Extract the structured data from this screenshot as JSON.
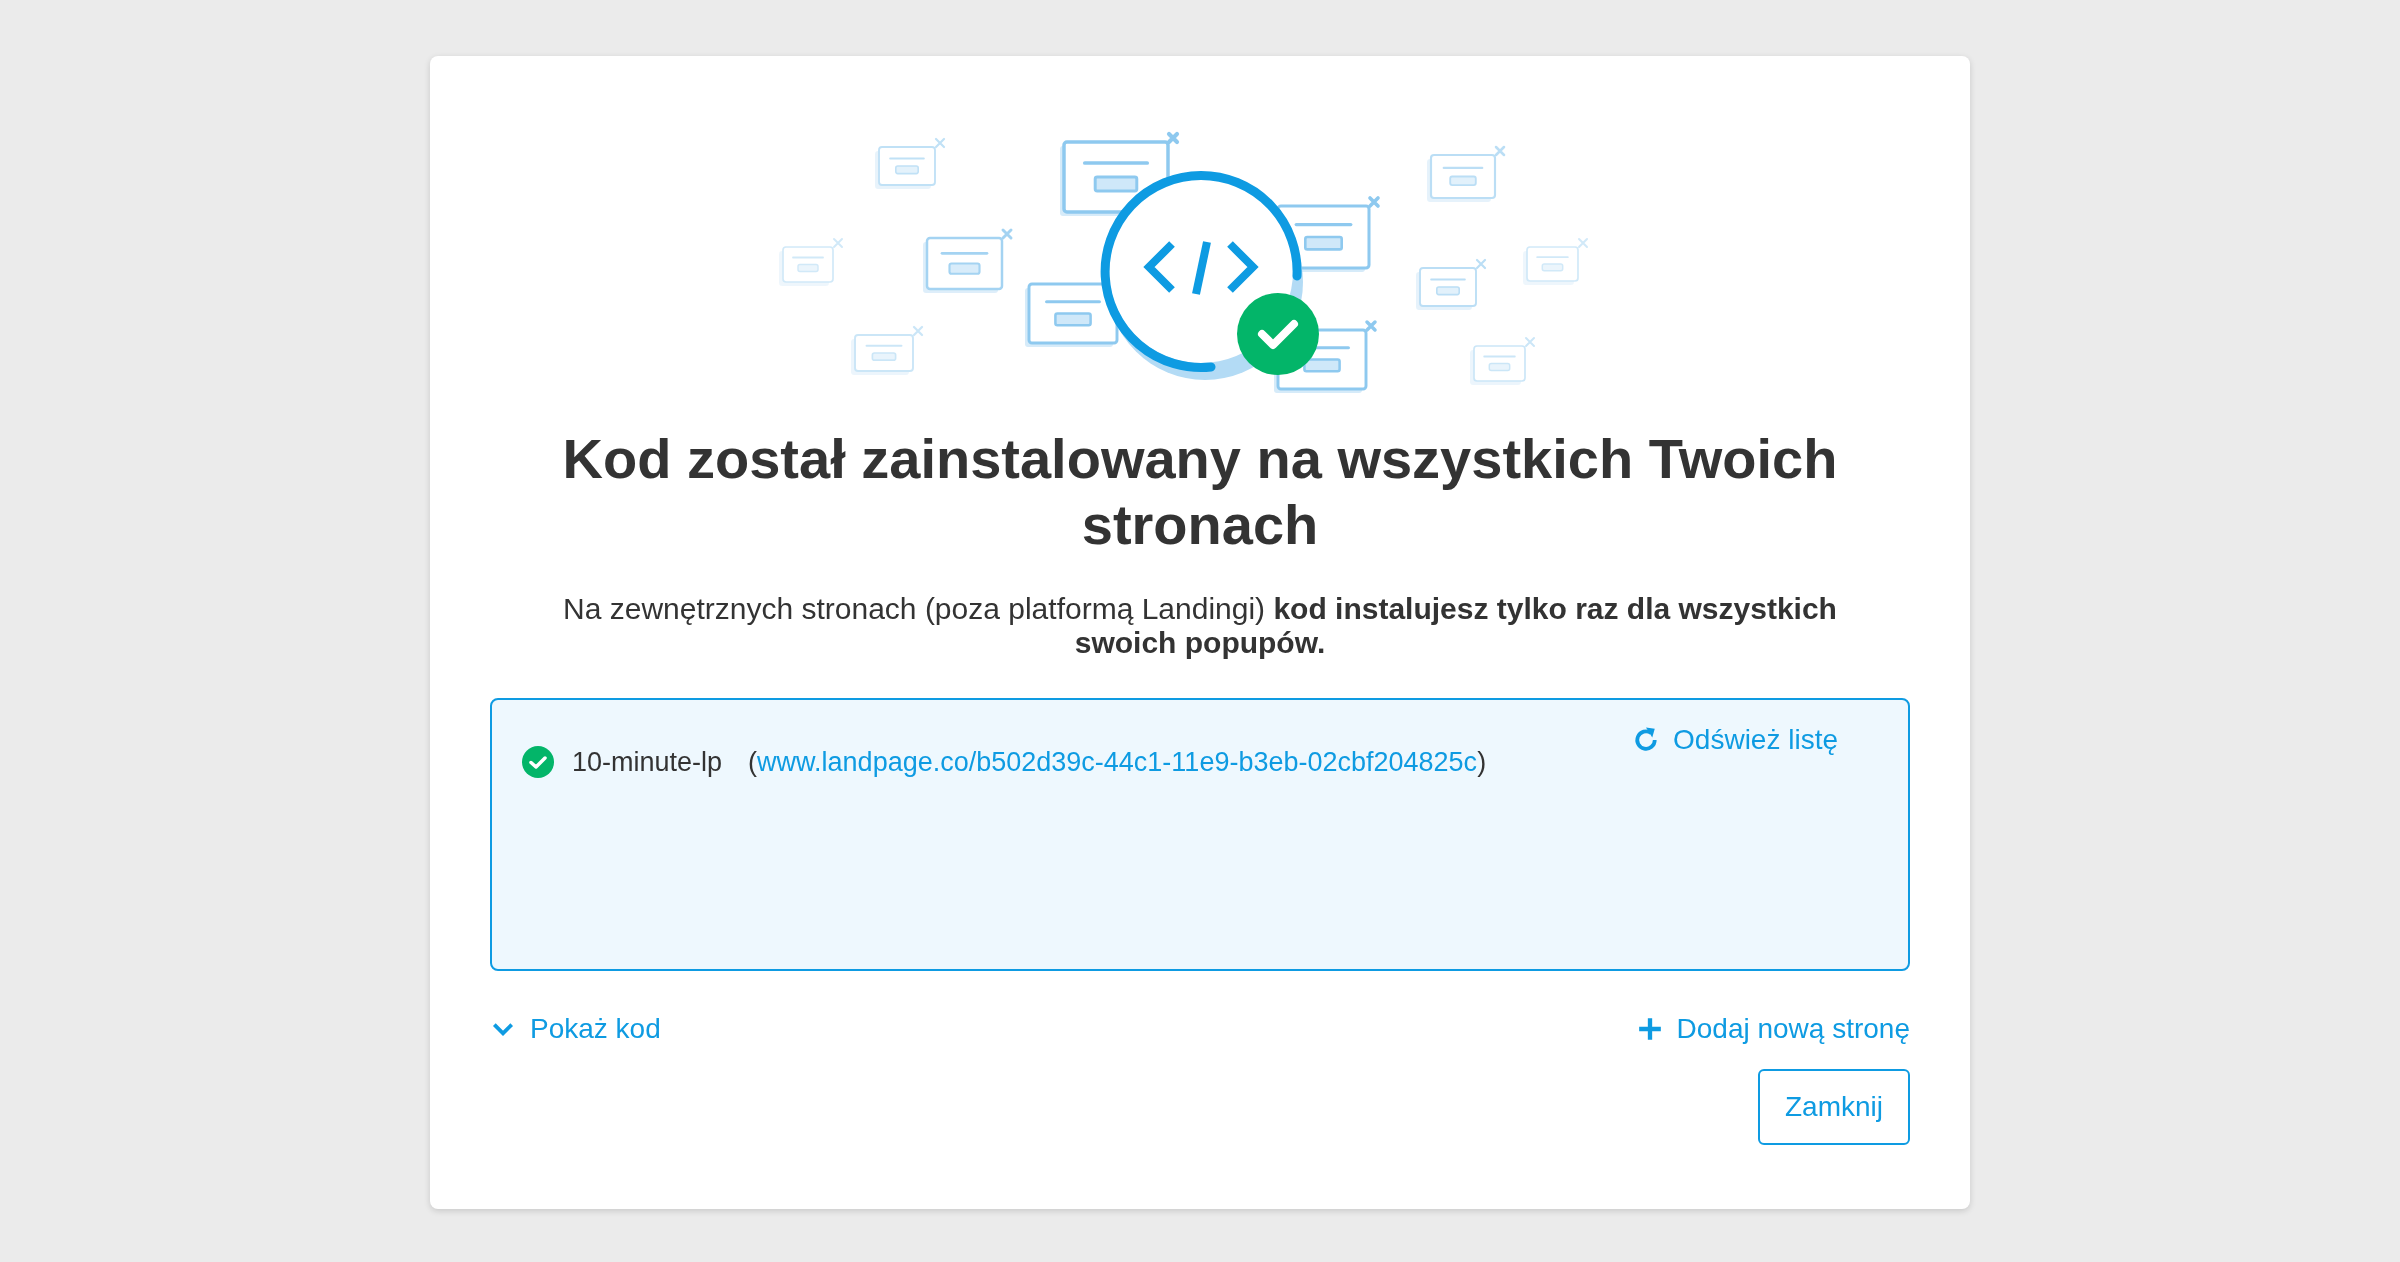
{
  "dialog": {
    "title": "Kod został zainstalowany na wszystkich Twoich stronach",
    "description": "Na zewnętrznych stronach (poza platformą Landingi) **kod instalujesz tylko raz dla wszystkich swoich popupów.**",
    "sites": [
      {
        "name": "10-minute-lp",
        "prefix": "(",
        "url": "www.landpage.co/b502d39c-44c1-11e9-b3eb-02cbf204825c",
        "suffix": ")",
        "installed": true
      }
    ],
    "refresh_link": "Odśwież listę",
    "show_code_link": "Pokaż kod",
    "add_page_link": "Dodaj nową stronę",
    "close_button": "Zamknij"
  }
}
